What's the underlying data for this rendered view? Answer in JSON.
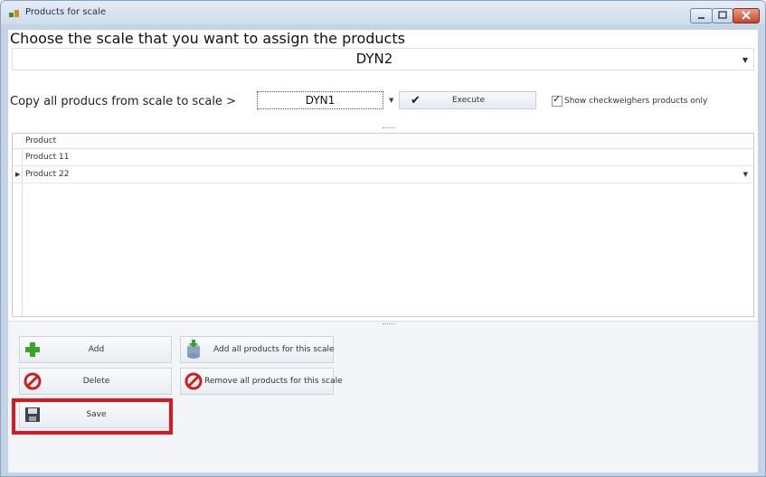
{
  "window": {
    "title": "Products for scale"
  },
  "header": {
    "prompt": "Choose the scale that you want to assign the products",
    "selected_scale": "DYN2"
  },
  "copy": {
    "label": "Copy all producs from scale to scale >",
    "from_scale": "DYN1",
    "execute_label": "Execute",
    "checkweighers_label": "Show checkweighers products only",
    "checkweighers_checked": true
  },
  "grid": {
    "column": "Product",
    "rows": [
      "Product 11",
      "Product 22"
    ]
  },
  "actions": {
    "add": "Add",
    "add_all": "Add all products for this scale",
    "delete": "Delete",
    "remove_all": "Remove all products for this scale",
    "save": "Save"
  }
}
